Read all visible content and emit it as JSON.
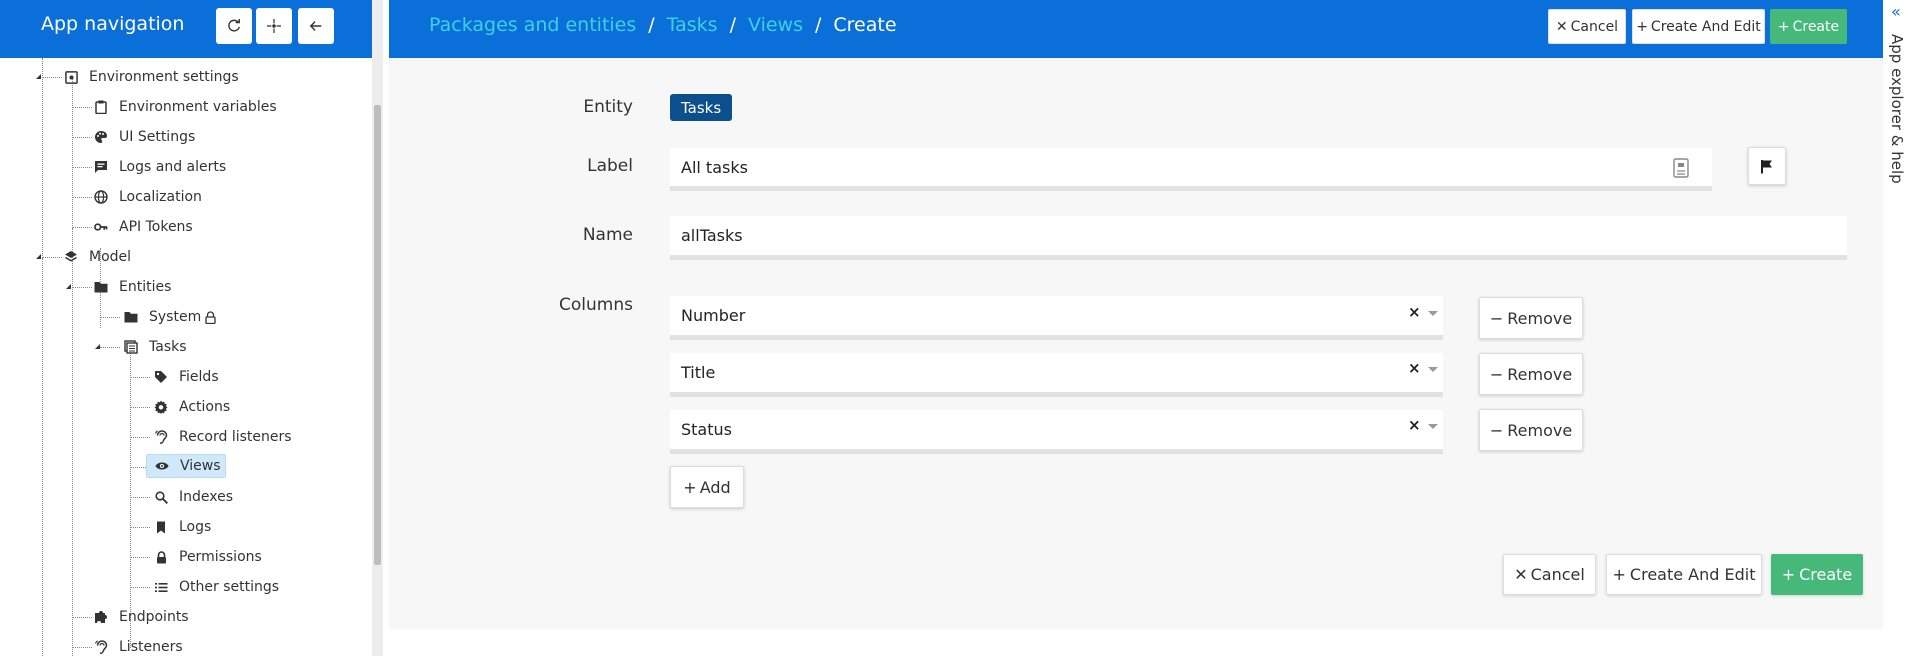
{
  "sidebar": {
    "title": "App navigation",
    "buttons": [
      "refresh",
      "crosshair",
      "back"
    ],
    "tree": {
      "environment_settings": "Environment settings",
      "environment_variables": "Environment variables",
      "ui_settings": "UI Settings",
      "logs_and_alerts": "Logs and alerts",
      "localization": "Localization",
      "api_tokens": "API Tokens",
      "model": "Model",
      "entities": "Entities",
      "system": "System",
      "tasks": "Tasks",
      "fields": "Fields",
      "actions": "Actions",
      "record_listeners": "Record listeners",
      "views": "Views",
      "indexes": "Indexes",
      "logs": "Logs",
      "permissions": "Permissions",
      "other_settings": "Other settings",
      "endpoints": "Endpoints",
      "listeners": "Listeners"
    }
  },
  "header": {
    "breadcrumb": [
      "Packages and entities",
      "Tasks",
      "Views",
      "Create"
    ],
    "separator": "/",
    "cancel": "Cancel",
    "create_and_edit": "Create And Edit",
    "create": "Create"
  },
  "form": {
    "entity_label": "Entity",
    "entity_value": "Tasks",
    "label_label": "Label",
    "label_value": "All tasks",
    "name_label": "Name",
    "name_value": "allTasks",
    "columns_label": "Columns",
    "columns": [
      "Number",
      "Title",
      "Status"
    ],
    "remove": "Remove",
    "add": "Add",
    "clear_symbol": "×",
    "cancel": "Cancel",
    "create_and_edit": "Create And Edit",
    "create": "Create"
  },
  "right_panel": {
    "label": "App explorer & help",
    "chevron": "«"
  },
  "colors": {
    "primary": "#0a6fd8",
    "breadcrumb_link": "#3fd0e6",
    "success": "#46b97a",
    "badge": "#0b4f8e",
    "selected": "#cfe8fb"
  }
}
